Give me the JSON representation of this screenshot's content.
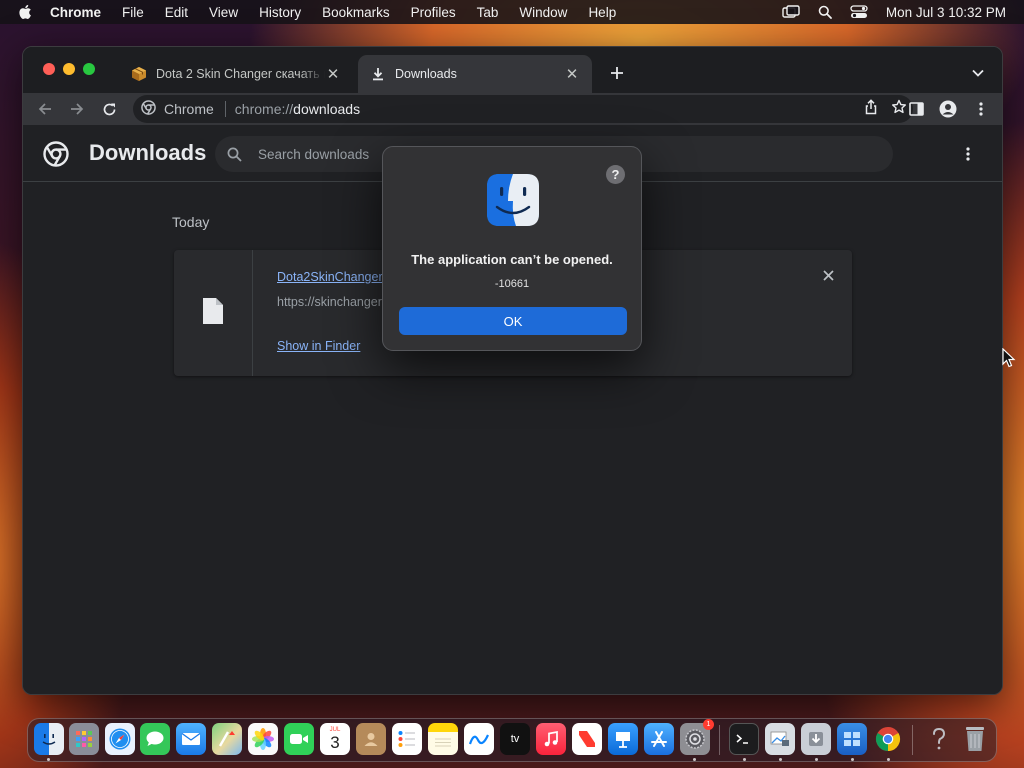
{
  "menubar": {
    "app_name": "Chrome",
    "items": [
      "File",
      "Edit",
      "View",
      "History",
      "Bookmarks",
      "Profiles",
      "Tab",
      "Window",
      "Help"
    ],
    "clock": "Mon Jul 3  10:32 PM"
  },
  "tabs": [
    {
      "title": "Dota 2 Skin Changer скачать п",
      "favicon": "package-icon",
      "active": false
    },
    {
      "title": "Downloads",
      "favicon": "download-icon",
      "active": true
    }
  ],
  "omnibox": {
    "chip_label": "Chrome",
    "url_scheme": "chrome://",
    "url_path": "downloads"
  },
  "downloads_page": {
    "title": "Downloads",
    "search_placeholder": "Search downloads",
    "section_label": "Today",
    "items": [
      {
        "file_name": "Dota2SkinChanger",
        "source_url": "https://skinchanger",
        "action_label": "Show in Finder",
        "icon": "file-icon"
      }
    ]
  },
  "dialog": {
    "icon": "finder-icon",
    "message": "The application can’t be opened.",
    "error_code": "-10661",
    "ok_label": "OK",
    "help_label": "?"
  },
  "dock": {
    "apps": [
      "Finder",
      "Launchpad",
      "Safari",
      "Messages",
      "Mail",
      "Maps",
      "Photos",
      "FaceTime",
      "Calendar",
      "Contacts",
      "Reminders",
      "Notes",
      "Freeform",
      "TV",
      "Music",
      "News",
      "Keynote",
      "App Store",
      "System Settings",
      "Terminal",
      "Preview",
      "Disk Utility",
      "Mission Control",
      "Chrome",
      "Help",
      "Trash"
    ],
    "calendar_month": "JUL",
    "calendar_day": "3",
    "tv_label": "tv",
    "settings_badge": "1"
  },
  "colors": {
    "accent_blue": "#1e6bd8",
    "link_blue": "#8ab4f8",
    "window_bg": "#202124"
  }
}
